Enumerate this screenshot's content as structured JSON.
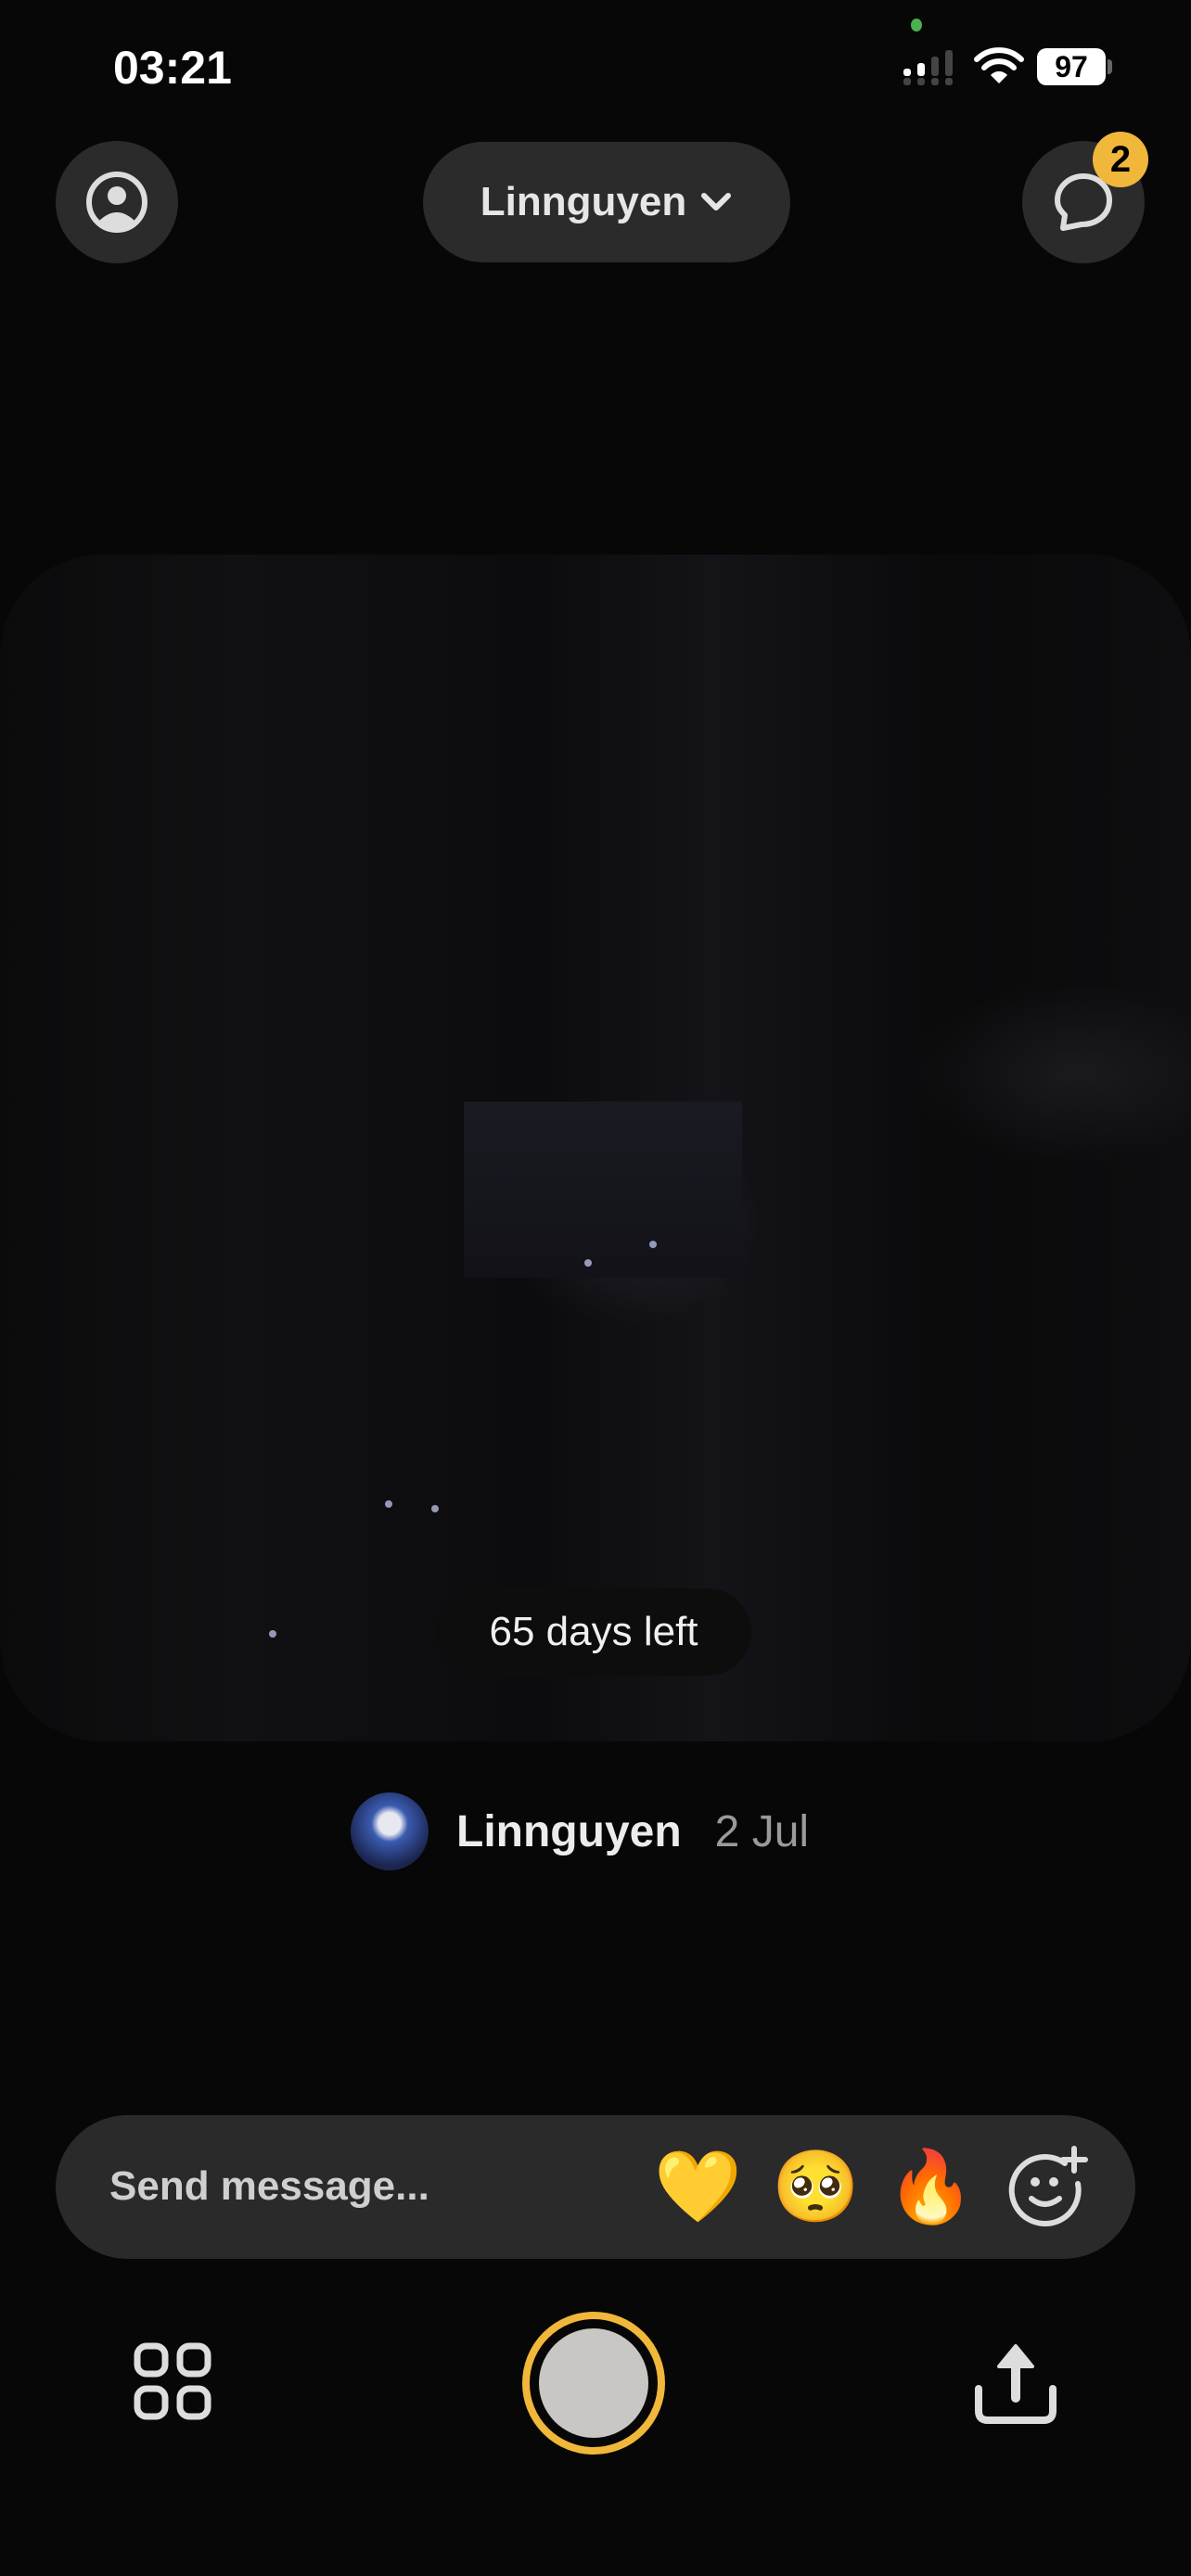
{
  "status_bar": {
    "time": "03:21",
    "battery": "97"
  },
  "header": {
    "title": "Linnguyen",
    "chat_badge": "2"
  },
  "post": {
    "days_left": "65 days left",
    "poster_name": "Linnguyen",
    "date": "2 Jul"
  },
  "message_bar": {
    "placeholder": "Send message...",
    "reactions": [
      "💛",
      "🥺",
      "🔥"
    ]
  },
  "colors": {
    "accent": "#f1b73a",
    "background": "#070707",
    "surface": "#2b2b2b"
  },
  "icons": [
    "profile-icon",
    "chevron-down-icon",
    "chat-bubble-icon",
    "add-emoji-icon",
    "grid-icon",
    "shutter-button",
    "share-icon"
  ]
}
